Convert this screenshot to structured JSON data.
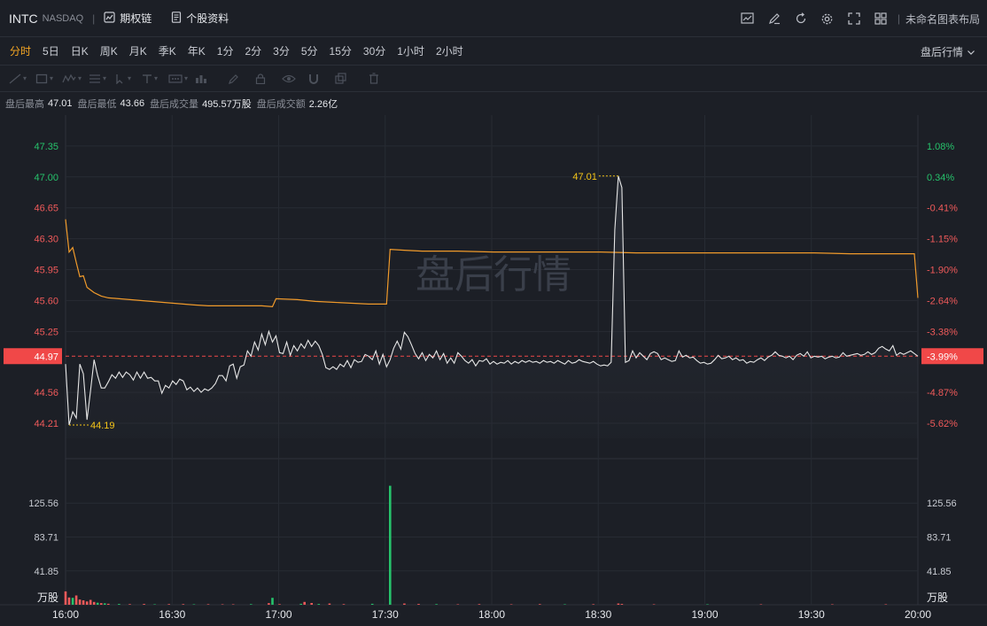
{
  "header": {
    "ticker": "INTC",
    "exchange": "NASDAQ",
    "sep": "|",
    "options_chain": "期权链",
    "stock_profile": "个股资料",
    "layout_name": "未命名图表布局"
  },
  "periods": [
    "分时",
    "5日",
    "日K",
    "周K",
    "月K",
    "季K",
    "年K",
    "1分",
    "2分",
    "3分",
    "5分",
    "15分",
    "30分",
    "1小时",
    "2小时"
  ],
  "active_period": "分时",
  "after_hours_mode": "盘后行情",
  "stats": {
    "high_label": "盘后最高",
    "high": "47.01",
    "low_label": "盘后最低",
    "low": "43.66",
    "vol_label": "盘后成交量",
    "vol": "495.57万股",
    "amt_label": "盘后成交额",
    "amt": "2.26亿"
  },
  "colors": {
    "up": "#f05a5a",
    "down": "#26c26b",
    "price_line": "#e6e6e6",
    "avg_line": "#f09a2b",
    "label_yellow": "#f5c518",
    "current_tag": "#f04848"
  },
  "chart_data": {
    "type": "line",
    "watermark": "盘后行情",
    "x_ticks": [
      "16:00",
      "16:30",
      "17:00",
      "17:30",
      "18:00",
      "18:30",
      "19:00",
      "19:30",
      "20:00"
    ],
    "y_price_ticks": [
      "47.35",
      "47.00",
      "46.65",
      "46.30",
      "45.95",
      "45.60",
      "45.25",
      "44.56",
      "44.21"
    ],
    "y_pct_ticks": [
      "1.08%",
      "0.34%",
      "-0.41%",
      "-1.15%",
      "-1.90%",
      "-2.64%",
      "-3.38%",
      "-4.87%",
      "-5.62%"
    ],
    "y_price_tick_values": [
      47.35,
      47.0,
      46.65,
      46.3,
      45.95,
      45.6,
      45.25,
      44.56,
      44.21
    ],
    "ylim": [
      44.04,
      47.7
    ],
    "prev_close": 44.97,
    "current_price_label": "44.97",
    "current_pct_label": "-3.99%",
    "high_marker": {
      "t": 155,
      "value": "47.01"
    },
    "low_marker": {
      "t": 1,
      "value": "44.19"
    },
    "volume_unit": "万股",
    "volume_ticks": [
      "125.56",
      "83.71",
      "41.85"
    ],
    "volume_tick_values": [
      125.56,
      83.71,
      41.85
    ],
    "volume_max": 167.4,
    "price": [
      [
        0,
        44.88
      ],
      [
        1,
        44.19
      ],
      [
        2,
        44.34
      ],
      [
        3,
        44.27
      ],
      [
        4,
        44.88
      ],
      [
        5,
        44.77
      ],
      [
        6,
        44.25
      ],
      [
        7,
        44.58
      ],
      [
        8,
        44.93
      ],
      [
        9,
        44.75
      ],
      [
        10,
        44.61
      ],
      [
        11,
        44.61
      ],
      [
        12,
        44.68
      ],
      [
        13,
        44.76
      ],
      [
        14,
        44.72
      ],
      [
        15,
        44.79
      ],
      [
        16,
        44.73
      ],
      [
        17,
        44.79
      ],
      [
        18,
        44.76
      ],
      [
        19,
        44.7
      ],
      [
        20,
        44.79
      ],
      [
        21,
        44.72
      ],
      [
        22,
        44.79
      ],
      [
        23,
        44.72
      ],
      [
        24,
        44.73
      ],
      [
        25,
        44.69
      ],
      [
        26,
        44.69
      ],
      [
        27,
        44.55
      ],
      [
        28,
        44.64
      ],
      [
        29,
        44.61
      ],
      [
        30,
        44.69
      ],
      [
        31,
        44.65
      ],
      [
        32,
        44.71
      ],
      [
        33,
        44.69
      ],
      [
        34,
        44.59
      ],
      [
        35,
        44.62
      ],
      [
        36,
        44.57
      ],
      [
        37,
        44.61
      ],
      [
        38,
        44.56
      ],
      [
        39,
        44.6
      ],
      [
        40,
        44.58
      ],
      [
        41,
        44.61
      ],
      [
        42,
        44.66
      ],
      [
        43,
        44.75
      ],
      [
        44,
        44.75
      ],
      [
        45,
        44.69
      ],
      [
        46,
        44.86
      ],
      [
        47,
        44.88
      ],
      [
        48,
        44.72
      ],
      [
        49,
        44.85
      ],
      [
        50,
        44.87
      ],
      [
        51,
        45.03
      ],
      [
        52,
        44.97
      ],
      [
        53,
        45.13
      ],
      [
        54,
        45.04
      ],
      [
        55,
        45.22
      ],
      [
        56,
        45.1
      ],
      [
        57,
        45.25
      ],
      [
        58,
        45.13
      ],
      [
        59,
        45.2
      ],
      [
        60,
        45.01
      ],
      [
        61,
        45.0
      ],
      [
        62,
        45.13
      ],
      [
        63,
        44.98
      ],
      [
        64,
        45.09
      ],
      [
        65,
        45.03
      ],
      [
        66,
        45.11
      ],
      [
        67,
        45.06
      ],
      [
        68,
        45.15
      ],
      [
        69,
        45.08
      ],
      [
        70,
        45.14
      ],
      [
        71,
        45.09
      ],
      [
        72,
        44.99
      ],
      [
        73,
        44.84
      ],
      [
        74,
        44.82
      ],
      [
        75,
        44.85
      ],
      [
        76,
        44.82
      ],
      [
        77,
        44.88
      ],
      [
        78,
        44.85
      ],
      [
        79,
        44.92
      ],
      [
        80,
        44.84
      ],
      [
        81,
        44.93
      ],
      [
        82,
        44.9
      ],
      [
        83,
        44.91
      ],
      [
        84,
        44.99
      ],
      [
        85,
        44.97
      ],
      [
        86,
        44.93
      ],
      [
        87,
        45.03
      ],
      [
        88,
        44.88
      ],
      [
        89,
        44.99
      ],
      [
        90,
        44.85
      ],
      [
        91,
        44.93
      ],
      [
        92,
        45.06
      ],
      [
        93,
        45.14
      ],
      [
        94,
        45.05
      ],
      [
        95,
        45.24
      ],
      [
        96,
        45.19
      ],
      [
        97,
        45.1
      ],
      [
        98,
        45.0
      ],
      [
        99,
        44.94
      ],
      [
        100,
        45.01
      ],
      [
        101,
        44.92
      ],
      [
        102,
        44.99
      ],
      [
        103,
        44.95
      ],
      [
        104,
        45.03
      ],
      [
        105,
        44.93
      ],
      [
        106,
        45.0
      ],
      [
        107,
        44.89
      ],
      [
        108,
        44.95
      ],
      [
        109,
        44.89
      ],
      [
        110,
        45.01
      ],
      [
        111,
        44.97
      ],
      [
        112,
        44.92
      ],
      [
        113,
        44.89
      ],
      [
        114,
        44.93
      ],
      [
        115,
        44.86
      ],
      [
        116,
        44.92
      ],
      [
        117,
        44.91
      ],
      [
        118,
        44.94
      ],
      [
        119,
        44.88
      ],
      [
        120,
        44.91
      ],
      [
        121,
        44.88
      ],
      [
        122,
        44.9
      ],
      [
        123,
        44.89
      ],
      [
        124,
        44.92
      ],
      [
        125,
        44.88
      ],
      [
        126,
        44.91
      ],
      [
        127,
        44.89
      ],
      [
        128,
        44.92
      ],
      [
        129,
        44.9
      ],
      [
        130,
        44.92
      ],
      [
        131,
        44.9
      ],
      [
        132,
        44.91
      ],
      [
        133,
        44.89
      ],
      [
        134,
        44.92
      ],
      [
        135,
        44.9
      ],
      [
        136,
        44.91
      ],
      [
        137,
        44.89
      ],
      [
        138,
        44.92
      ],
      [
        139,
        44.9
      ],
      [
        140,
        44.88
      ],
      [
        141,
        44.92
      ],
      [
        142,
        44.89
      ],
      [
        143,
        44.9
      ],
      [
        144,
        44.93
      ],
      [
        145,
        44.91
      ],
      [
        146,
        44.9
      ],
      [
        147,
        44.89
      ],
      [
        148,
        44.91
      ],
      [
        149,
        44.88
      ],
      [
        150,
        44.86
      ],
      [
        151,
        44.87
      ],
      [
        152,
        44.86
      ],
      [
        153,
        44.9
      ],
      [
        154,
        46.4
      ],
      [
        155,
        47.01
      ],
      [
        156,
        46.88
      ],
      [
        157,
        44.9
      ],
      [
        158,
        44.92
      ],
      [
        159,
        45.03
      ],
      [
        160,
        44.95
      ],
      [
        161,
        45.01
      ],
      [
        162,
        44.97
      ],
      [
        163,
        44.93
      ],
      [
        164,
        45.0
      ],
      [
        165,
        45.02
      ],
      [
        166,
        45.0
      ],
      [
        167,
        44.93
      ],
      [
        168,
        44.95
      ],
      [
        169,
        44.93
      ],
      [
        170,
        44.91
      ],
      [
        171,
        44.92
      ],
      [
        172,
        45.03
      ],
      [
        173,
        44.96
      ],
      [
        174,
        44.98
      ],
      [
        175,
        44.95
      ],
      [
        176,
        44.96
      ],
      [
        177,
        44.92
      ],
      [
        178,
        44.89
      ],
      [
        179,
        44.9
      ],
      [
        180,
        44.88
      ],
      [
        181,
        44.89
      ],
      [
        182,
        44.93
      ],
      [
        183,
        44.98
      ],
      [
        184,
        44.94
      ],
      [
        185,
        44.95
      ],
      [
        186,
        44.97
      ],
      [
        187,
        44.93
      ],
      [
        188,
        44.95
      ],
      [
        189,
        44.92
      ],
      [
        190,
        44.93
      ],
      [
        191,
        44.89
      ],
      [
        192,
        44.91
      ],
      [
        193,
        44.9
      ],
      [
        194,
        44.93
      ],
      [
        195,
        44.95
      ],
      [
        196,
        44.92
      ],
      [
        197,
        44.96
      ],
      [
        198,
        44.98
      ],
      [
        199,
        45.02
      ],
      [
        200,
        44.98
      ],
      [
        201,
        44.97
      ],
      [
        202,
        44.95
      ],
      [
        203,
        44.97
      ],
      [
        204,
        44.93
      ],
      [
        205,
        44.98
      ],
      [
        206,
        45.0
      ],
      [
        207,
        44.97
      ],
      [
        208,
        45.02
      ],
      [
        209,
        44.95
      ],
      [
        210,
        44.97
      ],
      [
        211,
        44.96
      ],
      [
        212,
        44.97
      ],
      [
        213,
        44.94
      ],
      [
        214,
        44.96
      ],
      [
        215,
        44.97
      ],
      [
        216,
        44.95
      ],
      [
        217,
        44.96
      ],
      [
        218,
        45.01
      ],
      [
        219,
        44.97
      ],
      [
        220,
        44.98
      ],
      [
        221,
        44.99
      ],
      [
        222,
        45.0
      ],
      [
        223,
        44.98
      ],
      [
        224,
        44.99
      ],
      [
        225,
        45.02
      ],
      [
        226,
        44.99
      ],
      [
        227,
        45.01
      ],
      [
        228,
        45.06
      ],
      [
        229,
        45.08
      ],
      [
        230,
        45.05
      ],
      [
        231,
        45.03
      ],
      [
        232,
        45.09
      ],
      [
        233,
        44.98
      ],
      [
        234,
        45.01
      ],
      [
        235,
        44.99
      ],
      [
        236,
        45.01
      ],
      [
        237,
        45.03
      ],
      [
        238,
        45.0
      ],
      [
        239,
        44.97
      ]
    ],
    "avg": [
      [
        0,
        46.52
      ],
      [
        1,
        46.15
      ],
      [
        2,
        46.2
      ],
      [
        3,
        46.03
      ],
      [
        4,
        45.87
      ],
      [
        5,
        45.88
      ],
      [
        6,
        45.75
      ],
      [
        7,
        45.72
      ],
      [
        8,
        45.69
      ],
      [
        9,
        45.67
      ],
      [
        10,
        45.65
      ],
      [
        12,
        45.63
      ],
      [
        15,
        45.62
      ],
      [
        18,
        45.61
      ],
      [
        21,
        45.6
      ],
      [
        24,
        45.59
      ],
      [
        27,
        45.58
      ],
      [
        30,
        45.57
      ],
      [
        33,
        45.56
      ],
      [
        36,
        45.55
      ],
      [
        40,
        45.54
      ],
      [
        45,
        45.54
      ],
      [
        50,
        45.54
      ],
      [
        55,
        45.54
      ],
      [
        58,
        45.53
      ],
      [
        59,
        45.62
      ],
      [
        65,
        45.61
      ],
      [
        70,
        45.59
      ],
      [
        75,
        45.58
      ],
      [
        80,
        45.57
      ],
      [
        85,
        45.56
      ],
      [
        90,
        45.56
      ],
      [
        91,
        46.18
      ],
      [
        95,
        46.17
      ],
      [
        100,
        46.16
      ],
      [
        110,
        46.16
      ],
      [
        120,
        46.15
      ],
      [
        130,
        46.15
      ],
      [
        140,
        46.15
      ],
      [
        150,
        46.15
      ],
      [
        160,
        46.14
      ],
      [
        170,
        46.14
      ],
      [
        180,
        46.14
      ],
      [
        190,
        46.14
      ],
      [
        200,
        46.14
      ],
      [
        210,
        46.14
      ],
      [
        220,
        46.13
      ],
      [
        230,
        46.13
      ],
      [
        238,
        46.13
      ],
      [
        239,
        45.63
      ]
    ],
    "volume": [
      [
        0,
        16.5,
        "up"
      ],
      [
        1,
        9.0,
        "up"
      ],
      [
        2,
        8.5,
        "down"
      ],
      [
        3,
        11.5,
        "up"
      ],
      [
        4,
        6.5,
        "up"
      ],
      [
        5,
        5.5,
        "up"
      ],
      [
        6,
        4.0,
        "up"
      ],
      [
        7,
        6.0,
        "up"
      ],
      [
        8,
        3.5,
        "up"
      ],
      [
        9,
        2.5,
        "down"
      ],
      [
        10,
        2.0,
        "up"
      ],
      [
        11,
        1.8,
        "down"
      ],
      [
        12,
        1.2,
        "up"
      ],
      [
        15,
        1.0,
        "down"
      ],
      [
        18,
        0.8,
        "up"
      ],
      [
        22,
        1.0,
        "up"
      ],
      [
        25,
        0.6,
        "down"
      ],
      [
        29,
        0.8,
        "up"
      ],
      [
        33,
        0.8,
        "up"
      ],
      [
        36,
        0.6,
        "down"
      ],
      [
        40,
        0.7,
        "up"
      ],
      [
        44,
        0.6,
        "up"
      ],
      [
        47,
        0.6,
        "up"
      ],
      [
        52,
        0.8,
        "down"
      ],
      [
        57,
        2.0,
        "up"
      ],
      [
        58,
        8.5,
        "down"
      ],
      [
        60,
        0.8,
        "up"
      ],
      [
        66,
        1.2,
        "down"
      ],
      [
        67,
        3.5,
        "up"
      ],
      [
        69,
        2.2,
        "up"
      ],
      [
        71,
        1.0,
        "down"
      ],
      [
        74,
        1.5,
        "up"
      ],
      [
        78,
        0.8,
        "up"
      ],
      [
        86,
        1.2,
        "down"
      ],
      [
        91,
        147.0,
        "down"
      ],
      [
        95,
        1.5,
        "up"
      ],
      [
        99,
        1.0,
        "up"
      ],
      [
        104,
        0.8,
        "down"
      ],
      [
        110,
        0.6,
        "up"
      ],
      [
        116,
        0.8,
        "up"
      ],
      [
        125,
        0.6,
        "up"
      ],
      [
        133,
        0.8,
        "up"
      ],
      [
        140,
        0.6,
        "down"
      ],
      [
        148,
        0.7,
        "up"
      ],
      [
        155,
        1.5,
        "up"
      ],
      [
        156,
        1.0,
        "up"
      ],
      [
        165,
        0.6,
        "up"
      ],
      [
        180,
        0.6,
        "down"
      ],
      [
        195,
        0.6,
        "up"
      ],
      [
        215,
        0.6,
        "up"
      ],
      [
        230,
        0.6,
        "up"
      ]
    ]
  }
}
